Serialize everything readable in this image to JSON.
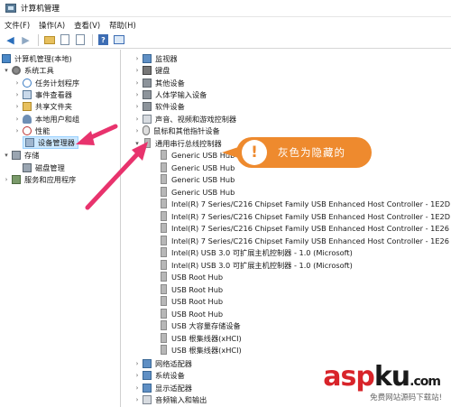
{
  "window": {
    "title": "计算机管理"
  },
  "menu": [
    "文件(F)",
    "操作(A)",
    "查看(V)",
    "帮助(H)"
  ],
  "left_tree": {
    "root": "计算机管理(本地)",
    "system_tools": "系统工具",
    "items": [
      "任务计划程序",
      "事件查看器",
      "共享文件夹",
      "本地用户和组",
      "性能",
      "设备管理器"
    ],
    "storage": "存储",
    "disk_mgmt": "磁盘管理",
    "services": "服务和应用程序"
  },
  "device_categories_top": [
    "监视器",
    "键盘",
    "其他设备",
    "人体学输入设备",
    "软件设备",
    "声音、视频和游戏控制器",
    "鼠标和其他指针设备"
  ],
  "usb_category": "通用串行总线控制器",
  "usb_devices": [
    "Generic USB Hub",
    "Generic USB Hub",
    "Generic USB Hub",
    "Generic USB Hub",
    "Intel(R) 7 Series/C216 Chipset Family USB Enhanced Host Controller - 1E2D",
    "Intel(R) 7 Series/C216 Chipset Family USB Enhanced Host Controller - 1E2D",
    "Intel(R) 7 Series/C216 Chipset Family USB Enhanced Host Controller - 1E26",
    "Intel(R) 7 Series/C216 Chipset Family USB Enhanced Host Controller - 1E26",
    "Intel(R) USB 3.0 可扩展主机控制器 - 1.0 (Microsoft)",
    "Intel(R) USB 3.0 可扩展主机控制器 - 1.0 (Microsoft)",
    "USB Root Hub",
    "USB Root Hub",
    "USB Root Hub",
    "USB Root Hub",
    "USB 大容量存储设备",
    "USB 根集线器(xHCI)",
    "USB 根集线器(xHCI)"
  ],
  "device_categories_bottom": [
    "网络适配器",
    "系统设备",
    "显示适配器",
    "音频输入和输出"
  ],
  "callout": {
    "text": "灰色为隐藏的",
    "mark": "!"
  },
  "watermark": {
    "brand_a": "asp",
    "brand_b": "ku",
    "brand_c": "",
    "brand_tld": ".com",
    "subtitle": "免费网站源码下载站!"
  },
  "colors": {
    "callout": "#ee8a2e",
    "arrow": "#e8336d",
    "selection": "#cce8ff"
  }
}
